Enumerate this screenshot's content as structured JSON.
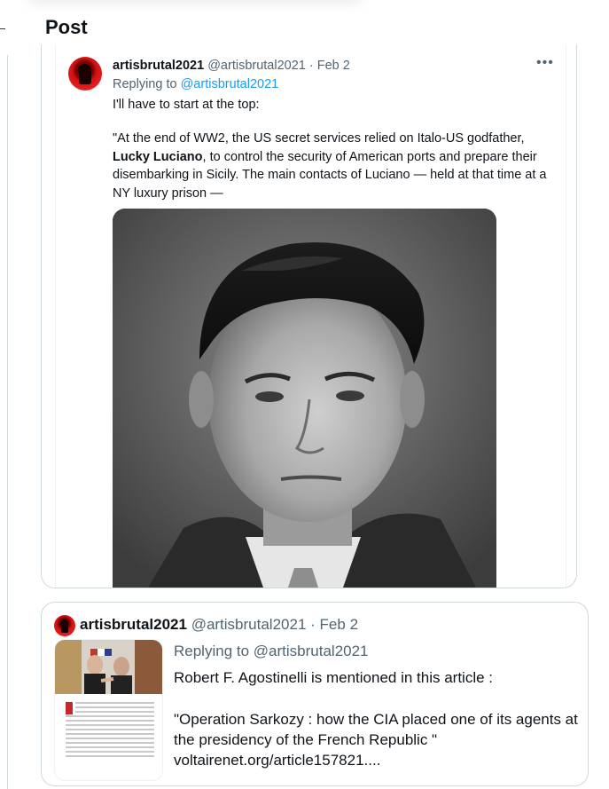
{
  "header": {
    "title": "Post"
  },
  "post": {
    "author_name": "artisbrutal2021",
    "author_handle": "@artisbrutal2021",
    "separator": "·",
    "date": "Feb 2",
    "more_label": "•••",
    "replying_prefix": "Replying to",
    "replying_mention": "@artisbrutal2021",
    "line1": "I'll have to start at the top:",
    "para_start": "\"At the end of WW2, the US secret services relied on Italo-US godfather, ",
    "para_bold": "Lucky Luciano",
    "para_end": ", to control the security of American ports and prepare their disembarking in Sicily. The main contacts of Luciano — held at that time at a NY luxury prison —"
  },
  "quoted": {
    "author_name": "artisbrutal2021",
    "author_handle": "@artisbrutal2021",
    "separator": "·",
    "date": "Feb 2",
    "replying_prefix": "Replying to",
    "replying_mention": "@artisbrutal2021",
    "line1": "Robert F. Agostinelli is mentioned in this article :",
    "line2": "\"Operation Sarkozy : how the CIA placed one of its agents at the presidency of the French Republic \" voltairenet.org/article157821...."
  },
  "colors": {
    "link": "#1d9bf0",
    "muted": "#536471",
    "border": "#cfd9de",
    "text": "#0f1419"
  },
  "icons": {
    "more": "more-horizontal-icon"
  }
}
